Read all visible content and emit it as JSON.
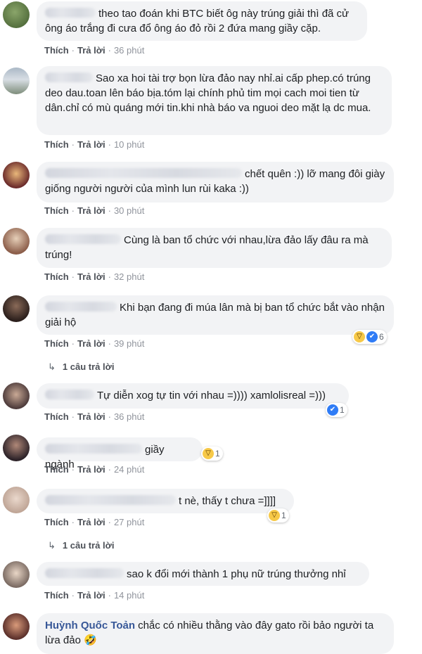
{
  "actions": {
    "like": "Thích",
    "reply": "Trả lời",
    "separator": "·"
  },
  "comments": [
    {
      "text": "theo tao đoán khi BTC biết ôg này trúng giải thì đã cử ông áo trắng đi cưa đổ ông áo đỏ rồi 2 đứa mang giầy cặp.",
      "time": "36 phút"
    },
    {
      "text": "Sao xa hoi tài trợ bọn lừa đảo nay nhỉ.ai cấp phep.có trúng deo dau.toan lên báo bịa.tóm lại chính phủ tim mọi cach moi tien từ dân.chỉ có mù quáng mới tin.khi nhà báo va nguoi deo mặt lạ dc mua.",
      "time": "10 phút"
    },
    {
      "text": "chết quên :)) lỡ mang đôi giày giống người người của mình lun rùi kaka :))",
      "time": "30 phút"
    },
    {
      "text": "Cùng là ban tổ chức với nhau,lừa đảo lấy đâu ra mà trúng!",
      "time": "32 phút"
    },
    {
      "text": "Khi bạn đang đi múa lân mà bị ban tổ chức bắt vào nhận giải hộ",
      "time": "39 phút",
      "reaction_count": "6",
      "reply_label": "1 câu trả lời"
    },
    {
      "text": "Tự diễn xog tự tin với nhau =)))) xamlolisreal =)))",
      "time": "36 phút",
      "reaction_count": "1"
    },
    {
      "text": "giầy ngành",
      "time": "24 phút",
      "reaction_count": "1"
    },
    {
      "text": "t nè, thấy t chưa =]]]]",
      "time": "27 phút",
      "reaction_count": "1",
      "reply_label": "1 câu trả lời"
    },
    {
      "text": "sao k đổi mới thành 1 phụ nữ trúng thưởng nhỉ",
      "time": "14 phút"
    },
    {
      "author": "Huỳnh Quốc Toản",
      "text": "chắc có nhiều thằng vào đây gato rồi bảo người ta lừa đảo 🤣"
    }
  ]
}
